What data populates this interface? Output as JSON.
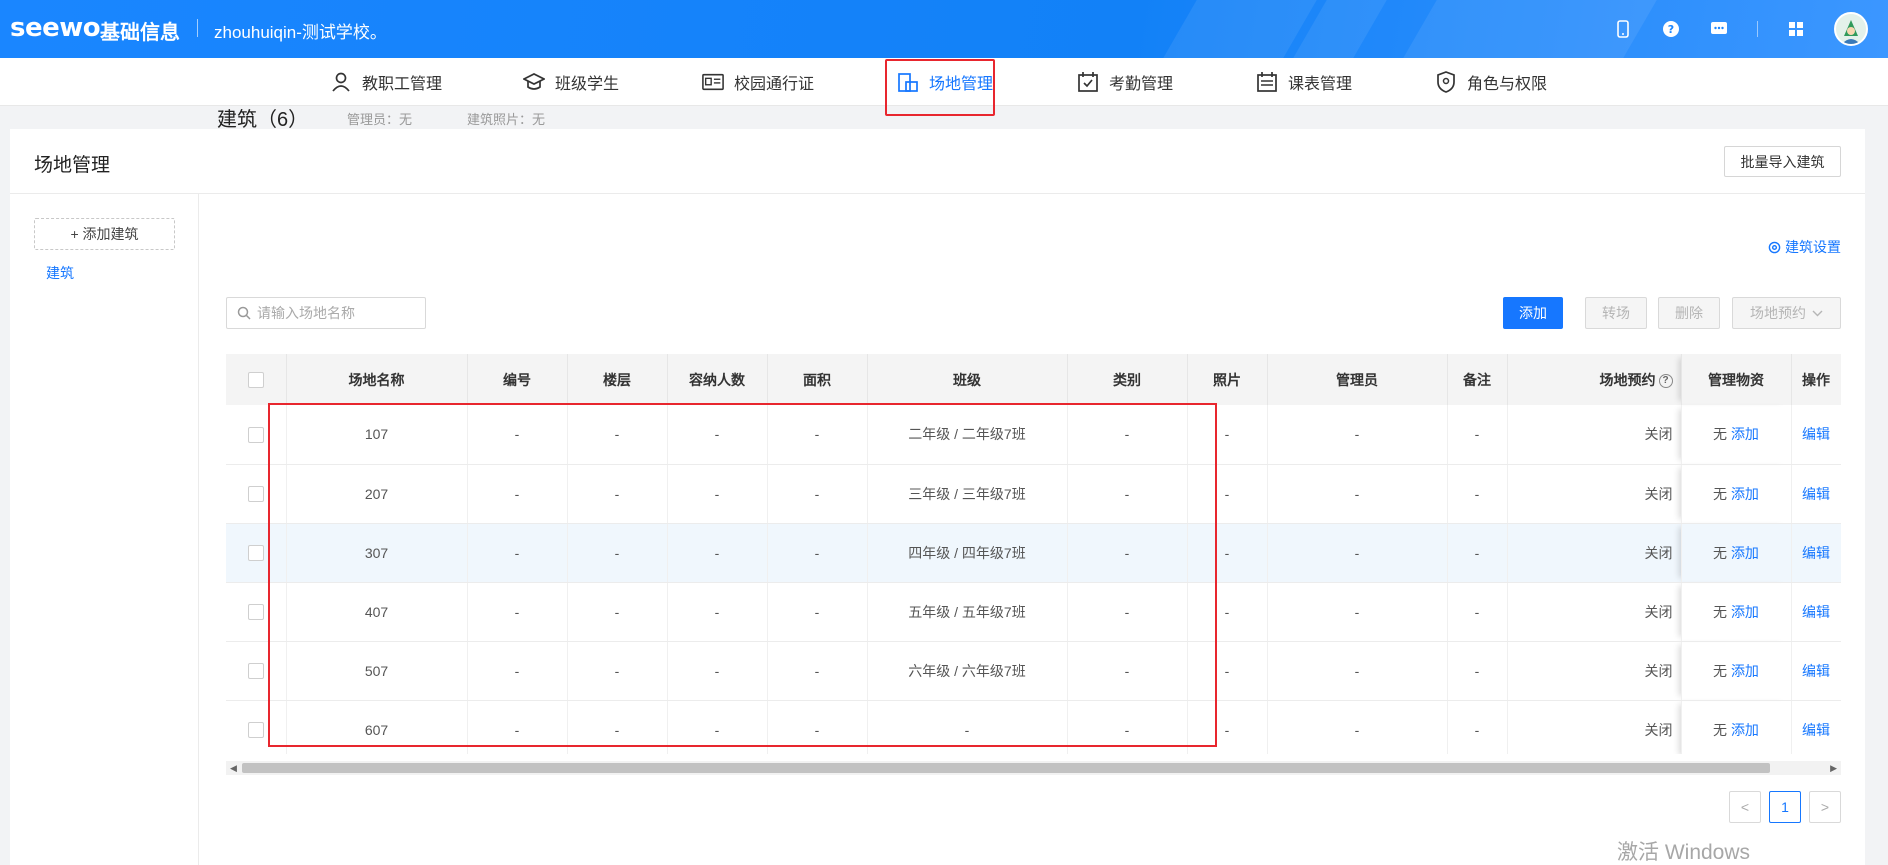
{
  "header": {
    "logo": "seewo",
    "app_name": "基础信息",
    "school": "zhouhuiqin-测试学校。"
  },
  "nav": {
    "items": [
      {
        "label": "教职工管理",
        "icon": "person-icon",
        "active": false
      },
      {
        "label": "班级学生",
        "icon": "graduation-cap-icon",
        "active": false
      },
      {
        "label": "校园通行证",
        "icon": "id-card-icon",
        "active": false
      },
      {
        "label": "场地管理",
        "icon": "venue-icon",
        "active": true
      },
      {
        "label": "考勤管理",
        "icon": "calendar-check-icon",
        "active": false
      },
      {
        "label": "课表管理",
        "icon": "timetable-icon",
        "active": false
      },
      {
        "label": "角色与权限",
        "icon": "shield-icon",
        "active": false
      }
    ]
  },
  "page": {
    "title": "场地管理",
    "import_button": "批量导入建筑"
  },
  "sidebar": {
    "add_button": "+ 添加建筑",
    "items": [
      "建筑"
    ]
  },
  "content": {
    "title": "建筑（6）",
    "admin_meta": "管理员：无",
    "photo_meta": "建筑照片：无",
    "settings_link": "建筑设置",
    "search_placeholder": "请输入场地名称"
  },
  "toolbar": {
    "add": "添加",
    "transfer": "转场",
    "delete": "删除",
    "reserve": "场地预约"
  },
  "table": {
    "columns": [
      "场地名称",
      "编号",
      "楼层",
      "容纳人数",
      "面积",
      "班级",
      "类别",
      "照片",
      "管理员",
      "备注",
      "场地预约",
      "管理物资",
      "操作"
    ],
    "rows": [
      {
        "name": "107",
        "number": "-",
        "floor": "-",
        "capacity": "-",
        "area": "-",
        "class": "二年级 / 二年级7班",
        "category": "-",
        "photo": "-",
        "admin": "-",
        "note": "-",
        "reservation": "关闭",
        "supplies": "无",
        "supplies_action": "添加",
        "action": "编辑"
      },
      {
        "name": "207",
        "number": "-",
        "floor": "-",
        "capacity": "-",
        "area": "-",
        "class": "三年级 / 三年级7班",
        "category": "-",
        "photo": "-",
        "admin": "-",
        "note": "-",
        "reservation": "关闭",
        "supplies": "无",
        "supplies_action": "添加",
        "action": "编辑"
      },
      {
        "name": "307",
        "number": "-",
        "floor": "-",
        "capacity": "-",
        "area": "-",
        "class": "四年级 / 四年级7班",
        "category": "-",
        "photo": "-",
        "admin": "-",
        "note": "-",
        "reservation": "关闭",
        "supplies": "无",
        "supplies_action": "添加",
        "action": "编辑"
      },
      {
        "name": "407",
        "number": "-",
        "floor": "-",
        "capacity": "-",
        "area": "-",
        "class": "五年级 / 五年级7班",
        "category": "-",
        "photo": "-",
        "admin": "-",
        "note": "-",
        "reservation": "关闭",
        "supplies": "无",
        "supplies_action": "添加",
        "action": "编辑"
      },
      {
        "name": "507",
        "number": "-",
        "floor": "-",
        "capacity": "-",
        "area": "-",
        "class": "六年级 / 六年级7班",
        "category": "-",
        "photo": "-",
        "admin": "-",
        "note": "-",
        "reservation": "关闭",
        "supplies": "无",
        "supplies_action": "添加",
        "action": "编辑"
      },
      {
        "name": "607",
        "number": "-",
        "floor": "-",
        "capacity": "-",
        "area": "-",
        "class": "-",
        "category": "-",
        "photo": "-",
        "admin": "-",
        "note": "-",
        "reservation": "关闭",
        "supplies": "无",
        "supplies_action": "添加",
        "action": "编辑"
      }
    ]
  },
  "pagination": {
    "prev": "<",
    "current": "1",
    "next": ">"
  },
  "watermark": "激活 Windows",
  "colors": {
    "accent": "#1677ff",
    "highlight": "#e8262e"
  }
}
